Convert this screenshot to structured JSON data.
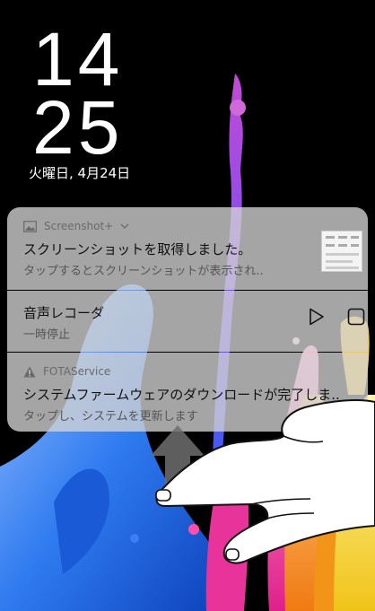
{
  "clock": {
    "hour": "14",
    "minute": "25"
  },
  "date": "火曜日, 4月24日",
  "notifications": [
    {
      "app": "Screenshot+",
      "app_icon": "image-icon",
      "title": "スクリーンショットを取得しました。",
      "text": "タップするとスクリーンショットが表示され.."
    },
    {
      "title": "音声レコーダ",
      "text": "一時停止",
      "actions": [
        "play-icon",
        "stop-icon"
      ]
    },
    {
      "app": "FOTAService",
      "app_icon": "warning-icon",
      "title": "システムファームウェアのダウンロードが完了しま..",
      "text": "タップし、システムを更新します"
    }
  ],
  "colors": {
    "background": "#000000",
    "notification_bg": "#d4d4d4",
    "paint_blue": "#1e6fd9",
    "paint_pink": "#e8339a",
    "paint_orange": "#f28c1a",
    "paint_yellow": "#f2d21a"
  }
}
